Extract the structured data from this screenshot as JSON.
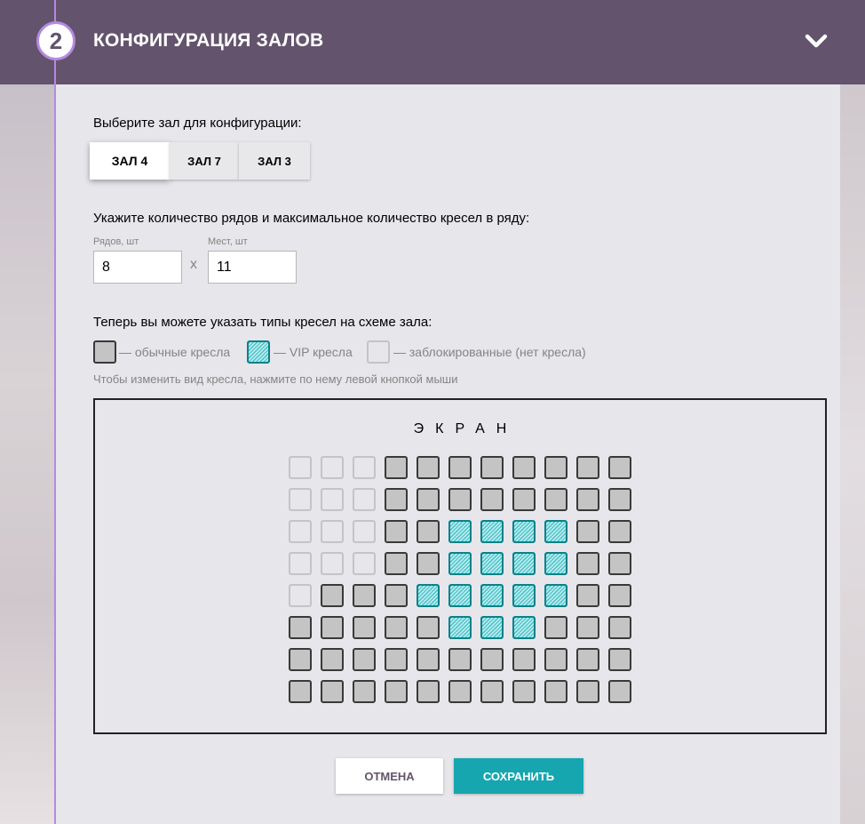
{
  "header": {
    "step_number": "2",
    "title": "КОНФИГУРАЦИЯ ЗАЛОВ",
    "collapse_icon": "chevron-down-icon",
    "bg_color": "#63536c",
    "accent_color": "#b48be0"
  },
  "hall_select": {
    "label": "Выберите зал для конфигурации:",
    "halls": [
      {
        "label": "ЗАЛ 4",
        "active": true
      },
      {
        "label": "ЗАЛ 7",
        "active": false
      },
      {
        "label": "ЗАЛ 3",
        "active": false
      }
    ]
  },
  "size": {
    "label": "Укажите количество рядов и максимальное количество кресел в ряду:",
    "rows_label": "Рядов, шт",
    "rows_value": "8",
    "separator": "x",
    "seats_label": "Мест, шт",
    "seats_value": "11"
  },
  "seat_types": {
    "label": "Теперь вы можете указать типы кресел на схеме зала:",
    "standart": "— обычные кресла",
    "vip": "— VIP кресла",
    "disabled": "— заблокированные (нет кресла)",
    "hint": "Чтобы изменить вид кресла, нажмите по нему левой кнопкой мыши"
  },
  "hall_scheme": {
    "screen_label": "ЭКРАН",
    "legend": {
      "standart": "s",
      "vip": "v",
      "disabled": "d"
    },
    "rows": [
      [
        "d",
        "d",
        "d",
        "s",
        "s",
        "s",
        "s",
        "s",
        "s",
        "s",
        "s"
      ],
      [
        "d",
        "d",
        "d",
        "s",
        "s",
        "s",
        "s",
        "s",
        "s",
        "s",
        "s"
      ],
      [
        "d",
        "d",
        "d",
        "s",
        "s",
        "v",
        "v",
        "v",
        "v",
        "s",
        "s"
      ],
      [
        "d",
        "d",
        "d",
        "s",
        "s",
        "v",
        "v",
        "v",
        "v",
        "s",
        "s"
      ],
      [
        "d",
        "s",
        "s",
        "s",
        "v",
        "v",
        "v",
        "v",
        "v",
        "s",
        "s"
      ],
      [
        "s",
        "s",
        "s",
        "s",
        "s",
        "v",
        "v",
        "v",
        "s",
        "s",
        "s"
      ],
      [
        "s",
        "s",
        "s",
        "s",
        "s",
        "s",
        "s",
        "s",
        "s",
        "s",
        "s"
      ],
      [
        "s",
        "s",
        "s",
        "s",
        "s",
        "s",
        "s",
        "s",
        "s",
        "s",
        "s"
      ]
    ]
  },
  "actions": {
    "cancel": "ОТМЕНА",
    "save": "СОХРАНИТЬ",
    "save_color": "#16a6af"
  }
}
